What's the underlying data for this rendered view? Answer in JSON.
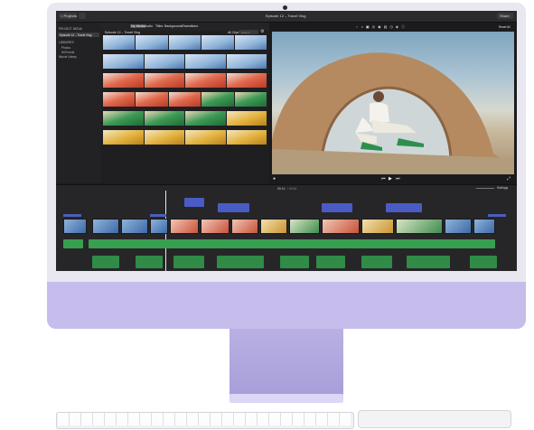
{
  "toolbar": {
    "projects_label": "< Projects",
    "project_title": "Episode 12 – Travel Vlog",
    "share_label": "Share"
  },
  "sidebar": {
    "section_label": "PROJECT MEDIA",
    "selected_item": "Episode 12 – Travel Vlog",
    "libraries_label": "LIBRARIES",
    "items": [
      "Photos",
      "All Events",
      "iMovie Library"
    ]
  },
  "browser": {
    "tabs": [
      "My Media",
      "Audio",
      "Titles",
      "Backgrounds",
      "Transitions"
    ],
    "header_title": "Episode 12 – Travel Vlog",
    "filter_label": "All Clips",
    "search_placeholder": "Search"
  },
  "viewer": {
    "settings_label": "Reset All"
  },
  "timeline": {
    "timecode": "00:14",
    "total": "/ 00:51",
    "settings_label": "Settings"
  },
  "colors": {
    "chassis": "#e9e7f0",
    "chin": "#c6bdec",
    "stand": "#a79ed8",
    "title_clip": "#4b5bc4",
    "audio_clip": "#3a9e50"
  }
}
